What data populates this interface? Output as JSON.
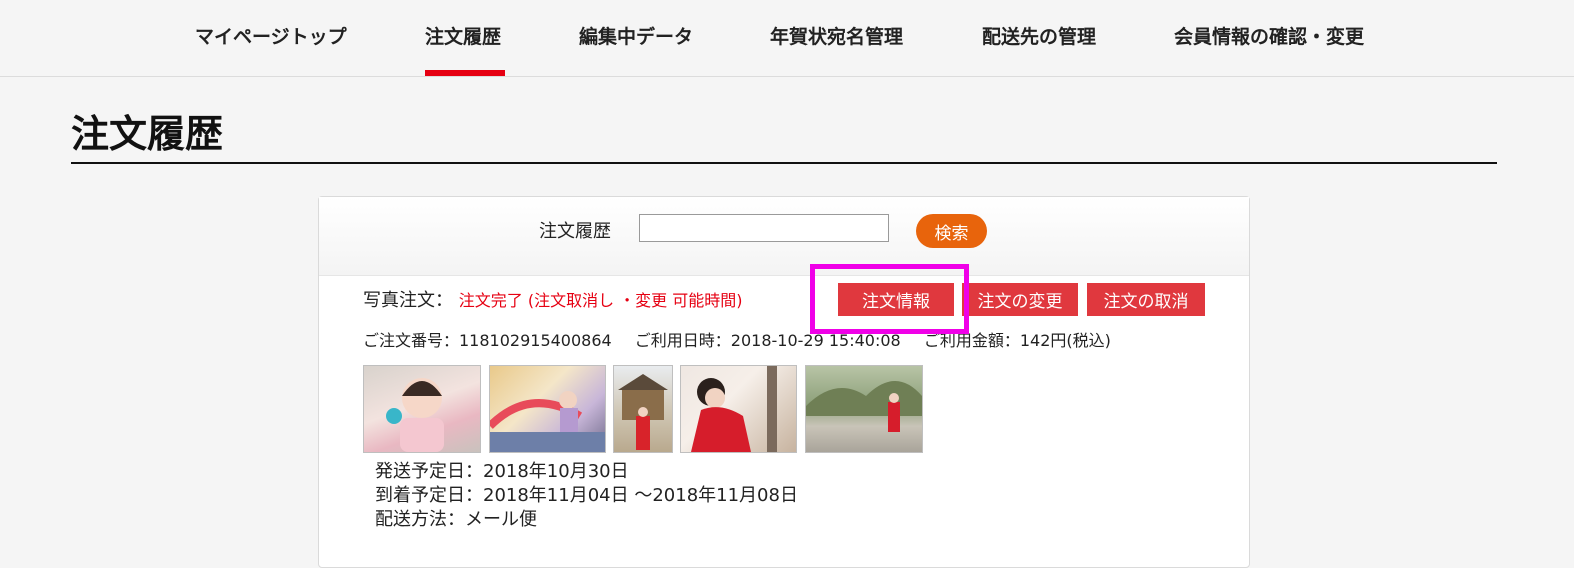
{
  "nav": {
    "items": [
      {
        "label": "マイページトップ"
      },
      {
        "label": "注文履歴"
      },
      {
        "label": "編集中データ"
      },
      {
        "label": "年賀状宛名管理"
      },
      {
        "label": "配送先の管理"
      },
      {
        "label": "会員情報の確認・変更"
      }
    ],
    "active": "注文履歴"
  },
  "page": {
    "title": "注文履歴"
  },
  "search": {
    "label": "注文履歴",
    "value": "",
    "button_label": "検索"
  },
  "order": {
    "type_label": "写真注文：",
    "status": "注文完了 (注文取消し ・変更 可能時間)",
    "buttons": {
      "info": "注文情報",
      "change": "注文の変更",
      "cancel": "注文の取消"
    },
    "number_label": "ご注文番号：118102915400864",
    "date_label": "ご利用日時：2018-10-29 15:40:08",
    "amount_label": "ご利用金額：142円(税込)",
    "thumbnails": [
      {
        "name": "baby-photo"
      },
      {
        "name": "playground-photo"
      },
      {
        "name": "shrine-photo"
      },
      {
        "name": "kimono-girl-photo"
      },
      {
        "name": "garden-photo"
      }
    ],
    "ship_date": "発送予定日：2018年10月30日",
    "arrival_date": "到着予定日：2018年11月04日 ～2018年11月08日",
    "ship_method": "配送方法：メール便"
  },
  "colors": {
    "accent_red": "#e60012",
    "button_red": "#e0383e",
    "search_orange": "#e8640c",
    "highlight_magenta": "#f000e8"
  }
}
